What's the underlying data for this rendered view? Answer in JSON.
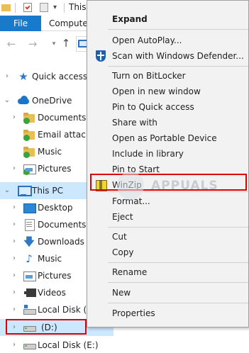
{
  "window": {
    "title": "This PC"
  },
  "ribbon": {
    "tabs": [
      "File",
      "Computer"
    ]
  },
  "nav_pane": {
    "items": [
      {
        "label": "Quick access",
        "icon": "star-icon"
      },
      {
        "label": "OneDrive",
        "icon": "cloud-icon"
      },
      {
        "label": "Documents",
        "icon": "folder-icon"
      },
      {
        "label": "Email attachm",
        "icon": "folder-icon"
      },
      {
        "label": "Music",
        "icon": "folder-icon"
      },
      {
        "label": "Pictures",
        "icon": "pictures-icon"
      },
      {
        "label": "This PC",
        "icon": "computer-icon"
      },
      {
        "label": "Desktop",
        "icon": "desktop-icon"
      },
      {
        "label": "Documents",
        "icon": "documents-icon"
      },
      {
        "label": "Downloads",
        "icon": "download-icon"
      },
      {
        "label": "Music",
        "icon": "music-icon"
      },
      {
        "label": "Pictures",
        "icon": "pictures-icon"
      },
      {
        "label": "Videos",
        "icon": "videos-icon"
      },
      {
        "label": "Local Disk (C:",
        "icon": "drive-icon"
      },
      {
        "label": "(D:)",
        "icon": "drive-icon"
      },
      {
        "label": "Local Disk (E:)",
        "icon": "drive-icon"
      }
    ]
  },
  "watermark": {
    "text": "APPUALS"
  },
  "context_menu": {
    "items": [
      {
        "label": "Expand",
        "bold": true
      },
      {
        "label": "Open AutoPlay..."
      },
      {
        "label": "Scan with Windows Defender...",
        "icon": "windows-defender-icon"
      },
      {
        "label": "Turn on BitLocker"
      },
      {
        "label": "Open in new window"
      },
      {
        "label": "Pin to Quick access"
      },
      {
        "label": "Share with"
      },
      {
        "label": "Open as Portable Device"
      },
      {
        "label": "Include in library"
      },
      {
        "label": "Pin to Start"
      },
      {
        "label": "WinZip",
        "icon": "winzip-icon"
      },
      {
        "label": "Format..."
      },
      {
        "label": "Eject"
      },
      {
        "label": "Cut"
      },
      {
        "label": "Copy"
      },
      {
        "label": "Rename"
      },
      {
        "label": "New"
      },
      {
        "label": "Properties"
      }
    ]
  },
  "colors": {
    "accent": "#1979ca",
    "selection": "#cce8ff",
    "highlight": "#e00000",
    "menu_bg": "#f2f2f2"
  }
}
